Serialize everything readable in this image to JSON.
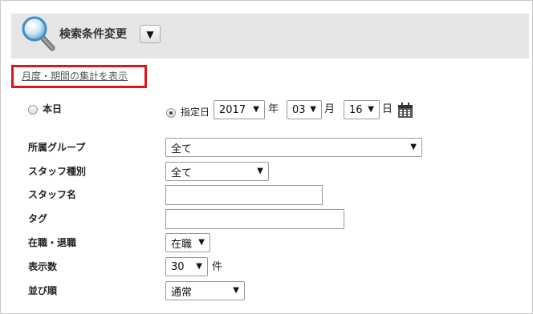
{
  "header": {
    "title": "検索条件変更",
    "toggle_glyph": "▼"
  },
  "link": {
    "monthly_summary": "月度・期間の集計を表示"
  },
  "common": {
    "arrow_glyph": "▼"
  },
  "date": {
    "today_label": "本日",
    "specified_label": "指定日",
    "selected_mode": "指定日",
    "year": "2017",
    "year_unit": "年",
    "month": "03",
    "month_unit": "月",
    "day": "16",
    "day_unit": "日"
  },
  "form": {
    "group_label": "所属グループ",
    "group_value": "全て",
    "staff_type_label": "スタッフ種別",
    "staff_type_value": "全て",
    "staff_name_label": "スタッフ名",
    "staff_name_value": "",
    "tag_label": "タグ",
    "tag_value": "",
    "status_label": "在職・退職",
    "status_value": "在職",
    "count_label": "表示数",
    "count_value": "30",
    "count_unit": "件",
    "sort_label": "並び順",
    "sort_value": "通常"
  },
  "colors": {
    "highlight_border": "#e1141b",
    "header_background": "#e6e6e6",
    "link_text": "#555555"
  }
}
